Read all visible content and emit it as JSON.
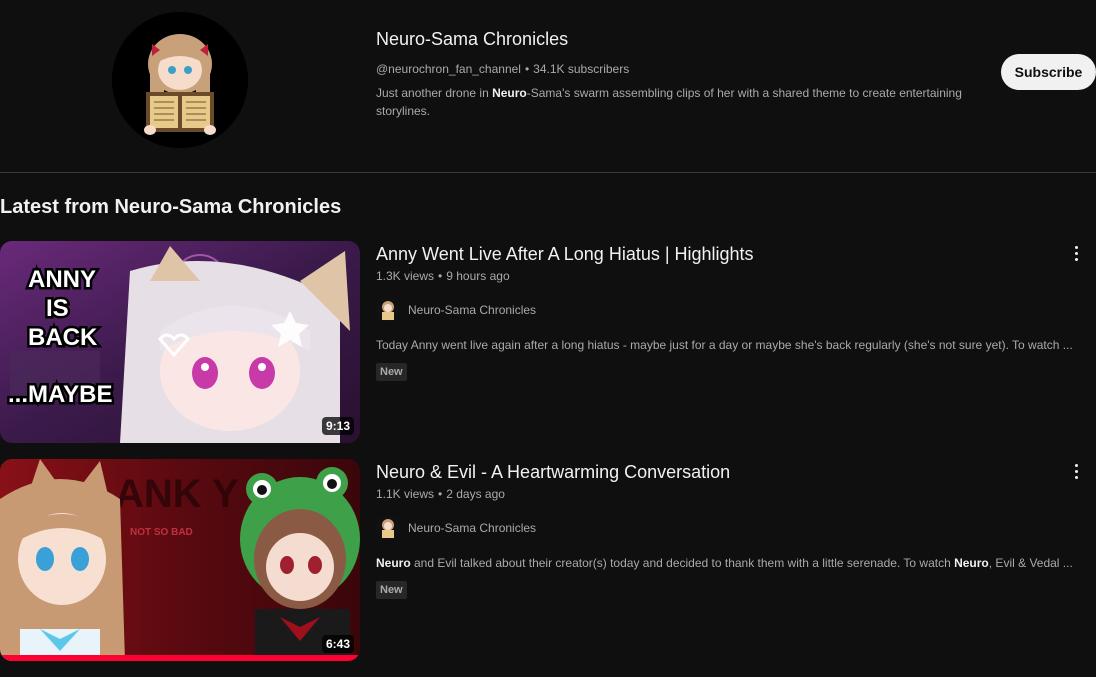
{
  "channel": {
    "name": "Neuro-Sama Chronicles",
    "handle": "@neurochron_fan_channel",
    "subscribers": "34.1K subscribers",
    "description_pre": "Just another drone in ",
    "description_bold": "Neuro",
    "description_post": "-Sama's swarm assembling clips of her with a shared theme to create entertaining storylines.",
    "subscribe_label": "Subscribe"
  },
  "section": {
    "title": "Latest from Neuro-Sama Chronicles"
  },
  "videos": [
    {
      "title": "Anny Went Live After A Long Hiatus | Highlights",
      "views": "1.3K views",
      "age": "9 hours ago",
      "channel_name": "Neuro-Sama Chronicles",
      "description": "Today Anny went live again after a long hiatus - maybe just for a day or maybe she's back regularly (she's not sure yet). To watch ...",
      "badge": "New",
      "duration": "9:13",
      "thumb_text": [
        "ANNY",
        "IS",
        "BACK",
        "...MAYBE"
      ]
    },
    {
      "title": "Neuro & Evil - A Heartwarming Conversation",
      "views": "1.1K views",
      "age": "2 days ago",
      "channel_name": "Neuro-Sama Chronicles",
      "desc_b1": "Neuro",
      "desc_t1": " and Evil talked about their creator(s) today and decided to thank them with a little serenade. To watch ",
      "desc_b2": "Neuro",
      "desc_t2": ", Evil & Vedal ...",
      "badge": "New",
      "duration": "6:43",
      "thumb_text": [
        "NOT SO BAD"
      ]
    }
  ],
  "colors": {
    "background": "#0f0f0f",
    "text_primary": "#f1f1f1",
    "text_secondary": "#aaaaaa",
    "subscribe_bg": "#f1f1f1"
  },
  "icons": {
    "more": "more-vert-icon",
    "dot": "separator-dot"
  }
}
